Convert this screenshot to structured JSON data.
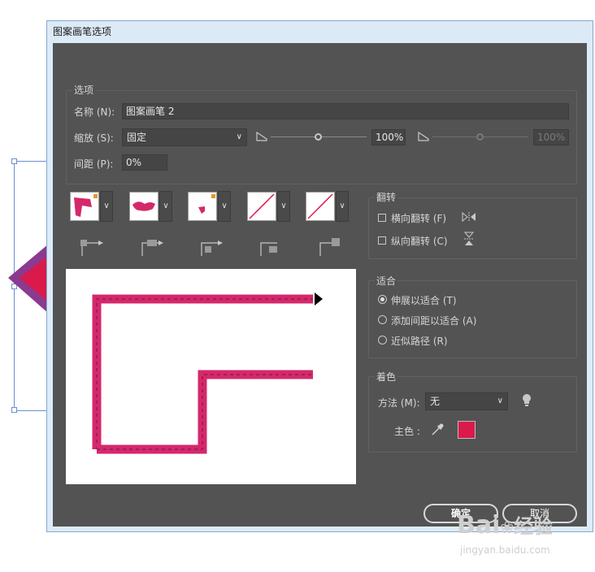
{
  "window": {
    "title": "图案画笔选项"
  },
  "options": {
    "group_label": "选项",
    "name_label": "名称 (N):",
    "name_value": "图案画笔 2",
    "scale_label": "缩放 (S):",
    "scale_value": "固定",
    "scale_percent": "100%",
    "scale_percent_2": "100%",
    "spacing_label": "间距 (P):",
    "spacing_value": "0%"
  },
  "flip": {
    "group_label": "翻转",
    "horizontal_label": "横向翻转 (F)",
    "vertical_label": "纵向翻转 (C)"
  },
  "fit": {
    "group_label": "适合",
    "options": [
      "伸展以适合 (T)",
      "添加间距以适合 (A)",
      "近似路径 (R)"
    ],
    "selected_index": 0
  },
  "colorization": {
    "group_label": "着色",
    "method_label": "方法 (M):",
    "method_value": "无",
    "key_color_label": "主色 :",
    "key_color": "#d91a4b"
  },
  "buttons": {
    "ok": "确定",
    "cancel": "取消"
  },
  "watermark": {
    "brand": "Bai",
    "brand_suffix": "经验",
    "url": "jingyan.baidu.com"
  },
  "colors": {
    "accent": "#d91a4b",
    "panel": "#535353",
    "brush_pink": "#d5286a"
  }
}
